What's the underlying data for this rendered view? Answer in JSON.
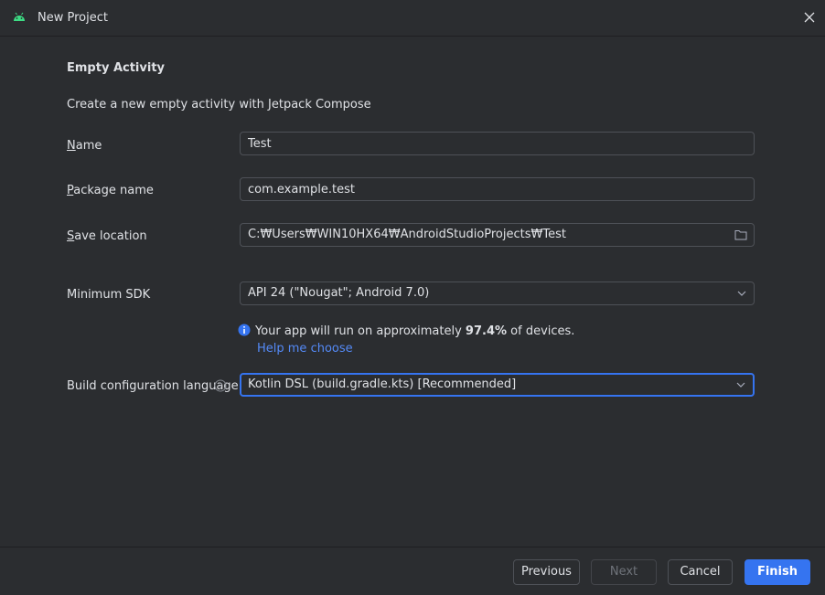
{
  "window": {
    "title": "New Project"
  },
  "page": {
    "heading": "Empty Activity",
    "subtitle": "Create a new empty activity with Jetpack Compose"
  },
  "form": {
    "name": {
      "mnemonic": "N",
      "label_rest": "ame",
      "value": "Test"
    },
    "package": {
      "mnemonic": "P",
      "label_rest": "ackage name",
      "value": "com.example.test"
    },
    "save_location": {
      "mnemonic": "S",
      "label_rest": "ave location",
      "value": "C:₩Users₩WIN10HX64₩AndroidStudioProjects₩Test"
    },
    "min_sdk": {
      "label": "Minimum SDK",
      "value": "API 24 (\"Nougat\"; Android 7.0)"
    },
    "info": {
      "prefix": "Your app will run on approximately ",
      "percent": "97.4%",
      "suffix": " of devices.",
      "link": "Help me choose"
    },
    "build_lang": {
      "label": "Build configuration language",
      "value": "Kotlin DSL (build.gradle.kts) [Recommended]"
    }
  },
  "buttons": {
    "previous": "Previous",
    "next": "Next",
    "cancel": "Cancel",
    "finish": "Finish"
  },
  "colors": {
    "background": "#2b2d30",
    "accent": "#3574f0",
    "link": "#548af7",
    "android_green": "#3ddc84"
  },
  "icons": [
    "android-icon",
    "close-icon",
    "folder-icon",
    "chevron-down-icon",
    "info-icon",
    "help-question-icon"
  ]
}
